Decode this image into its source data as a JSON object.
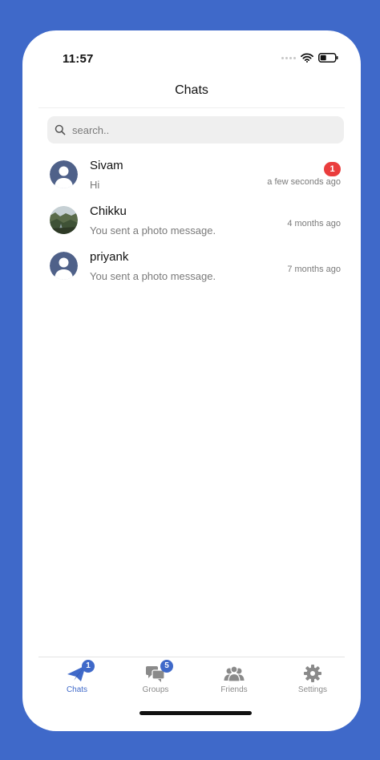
{
  "status_bar": {
    "time": "11:57",
    "icons": [
      "signal-dots-icon",
      "wifi-icon",
      "battery-icon"
    ]
  },
  "header": {
    "title": "Chats"
  },
  "search": {
    "placeholder": "search.."
  },
  "chats": [
    {
      "name": "Sivam",
      "preview": "Hi",
      "time": "a few seconds ago",
      "unread": "1",
      "avatar": "default-avatar-icon"
    },
    {
      "name": "Chikku",
      "preview": "You sent a photo message.",
      "time": "4 months ago",
      "avatar": "landscape-photo-avatar"
    },
    {
      "name": "priyank",
      "preview": "You sent a photo message.",
      "time": "7 months ago",
      "avatar": "default-avatar-icon"
    }
  ],
  "tabs": [
    {
      "label": "Chats",
      "icon": "paper-plane-icon",
      "badge": "1",
      "active": true
    },
    {
      "label": "Groups",
      "icon": "chat-bubbles-icon",
      "badge": "5",
      "active": false
    },
    {
      "label": "Friends",
      "icon": "people-icon",
      "active": false
    },
    {
      "label": "Settings",
      "icon": "gear-icon",
      "active": false
    }
  ],
  "colors": {
    "background": "#3f69c9",
    "accent": "#3f69c9",
    "badge_red": "#ea3d3d",
    "muted_text": "#7a7a7a"
  }
}
